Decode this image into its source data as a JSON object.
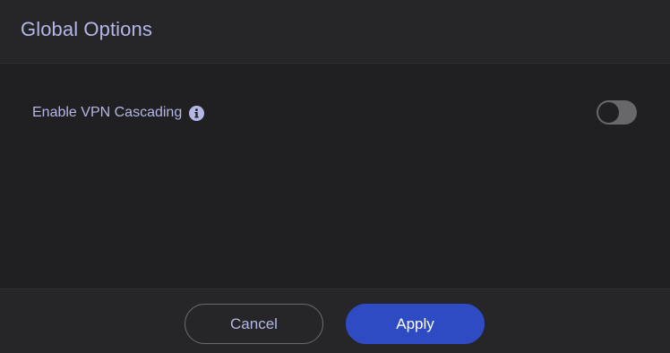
{
  "dialog": {
    "title": "Global Options",
    "options": [
      {
        "label": "Enable VPN Cascading",
        "info_icon": "info-icon",
        "toggle_state": "off"
      }
    ],
    "buttons": {
      "cancel_label": "Cancel",
      "apply_label": "Apply"
    }
  },
  "colors": {
    "text_accent": "#b4b6e6",
    "apply_button": "#2f4bc4",
    "background": "#202023",
    "toggle_off_track": "#68686b"
  }
}
